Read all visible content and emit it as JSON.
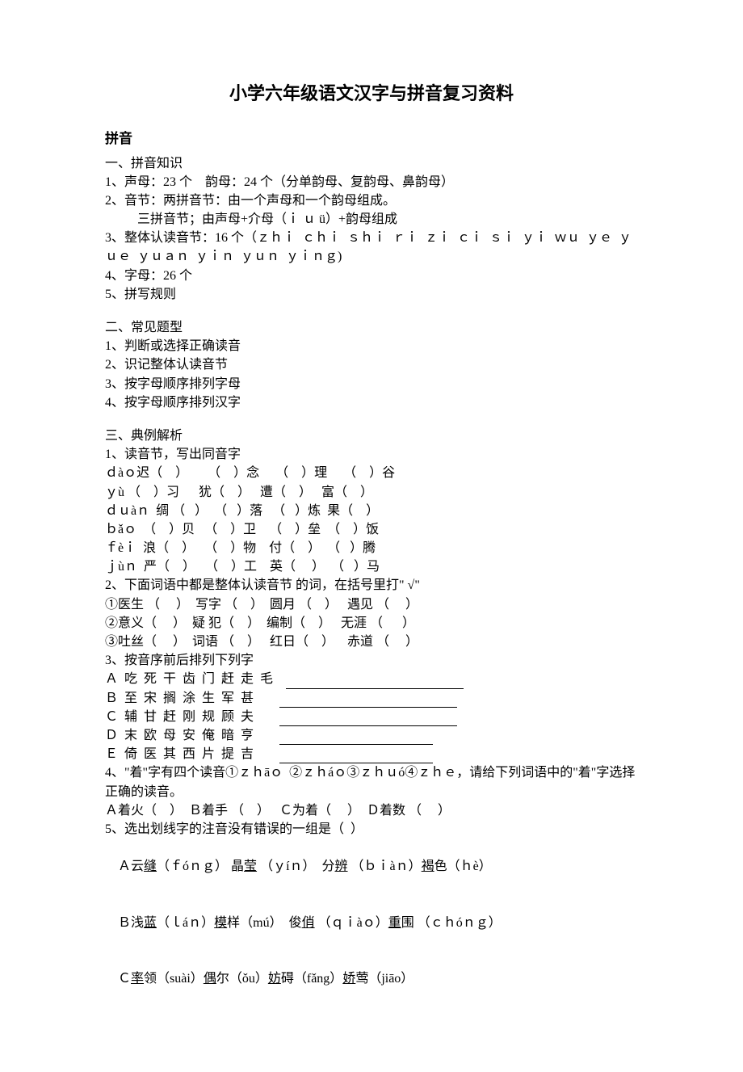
{
  "title": "小学六年级语文汉字与拼音复习资料",
  "pinyin_header": "拼音",
  "section1": {
    "heading": "一、拼音知识",
    "items": [
      "1、声母：23 个    韵母：24 个（分单韵母、复韵母、鼻韵母）",
      "2、音节：两拼音节：由一个声母和一个韵母组成。",
      "          三拼音节；由声母+介母（ｉ ｕ ü）+韵母组成",
      "3、整体认读音节：16 个（ｚｈｉ  ｃｈｉ  ｓｈｉ  ｒｉ  ｚｉ  ｃｉ  ｓｉ  ｙｉ  ｗｕ  ｙｅ  ｙｕｅ  ｙｕａｎ  ｙｉｎ  ｙｕｎ  ｙｉｎｇ)",
      "4、字母：26 个",
      "5、拼写规则"
    ]
  },
  "section2": {
    "heading": "二、常见题型",
    "items": [
      "1、判断或选择正确读音",
      "2、识记整体认读音节",
      "3、按字母顺序排列字母",
      "4、按字母顺序排列汉字"
    ]
  },
  "section3": {
    "heading": "三、典例解析",
    "q1_heading": "1、读音节，写出同音字",
    "q1_rows": [
      "ｄàｏ迟（    ）      （    ）念     （    ）理     （    ）谷",
      "ｙù （    ）习      犹（    ）   遭（    ）   富（    ）",
      "ｄｕàｎ  绸 （   ）  （   ）落   （   ）炼  果（    ）",
      "ｂǎｏ  （    ）贝   （    ）卫    （    ）垒  （    ）饭",
      "ｆèｉ  浪（    ）   （    ）物    付（    ）  （   ）腾",
      "ｊùｎ  严（    ）   （    ）工    英（     ）  （   ）马"
    ],
    "q2_heading": "2、下面词语中都是整体认读音节 的词，在括号里打\" √\"",
    "q2_rows": [
      "①医生 （     ）  写字 （    ）  圆月 （    ）   遇见 （     ）",
      "②意义（     ）  疑 犯（    ）  编制（    ）   无涯 （      ）",
      "③吐丝（     ）  词语 （    ）   红日（    ）    赤道 （     ）"
    ],
    "q3_heading": "3、按音序前后排列下列字",
    "q3_rows": [
      {
        "text": "Ａ  吃  死  干  齿  门  赶  走  毛    "
      },
      {
        "text": "Ｂ  至  宋  搁  涂  生  军  甚        "
      },
      {
        "text": "Ｃ  辅  甘  赶  刚  规  顾  夫        "
      },
      {
        "text": "Ｄ  末  欧  母  安  俺  暗  亨        "
      },
      {
        "text": "Ｅ  倚  医  其  西  片  提  吉        "
      }
    ],
    "q4_heading": "4、\"着\"字有四个读音①ｚｈāｏ  ②ｚｈáｏ③ｚｈｕó④ｚｈｅ，请给下列词语中的\"着\"字选择正确的读音。",
    "q4_row": "Ａ着火（    ）  Ｂ着手 （    ）   Ｃ为着（     ）  Ｄ着数 （     ）",
    "q5_heading": "5、选出划线字的注音没有错误的一组是（  ）",
    "q5_rows": [
      {
        "prefix": "Ａ云",
        "u1": "缝",
        "mid1": "（ｆóｎｇ） 晶",
        "u2": "莹",
        "mid2": " （ｙíｎ）  分",
        "u3": "辨",
        "mid3": " （ｂｉàｎ）",
        "u4": "褐",
        "mid4": "色（ｈè）"
      },
      {
        "prefix": "Ｂ浅",
        "u1": "蓝",
        "mid1": "（ｌáｎ）",
        "u2": "模",
        "mid2": "样（mú）  俊",
        "u3": "俏",
        "mid3": " （ｑｉàｏ）",
        "u4": "重",
        "mid4": "围 （ｃｈóｎｇ）"
      },
      {
        "prefix": "Ｃ",
        "u1": "率",
        "mid1": "领（suài）",
        "u2": "偶",
        "mid2": "尔（ǒu）",
        "u3": "妨",
        "mid3": "碍（fǎng）",
        "u4": "娇",
        "mid4": "莺（jiāo）"
      }
    ]
  }
}
